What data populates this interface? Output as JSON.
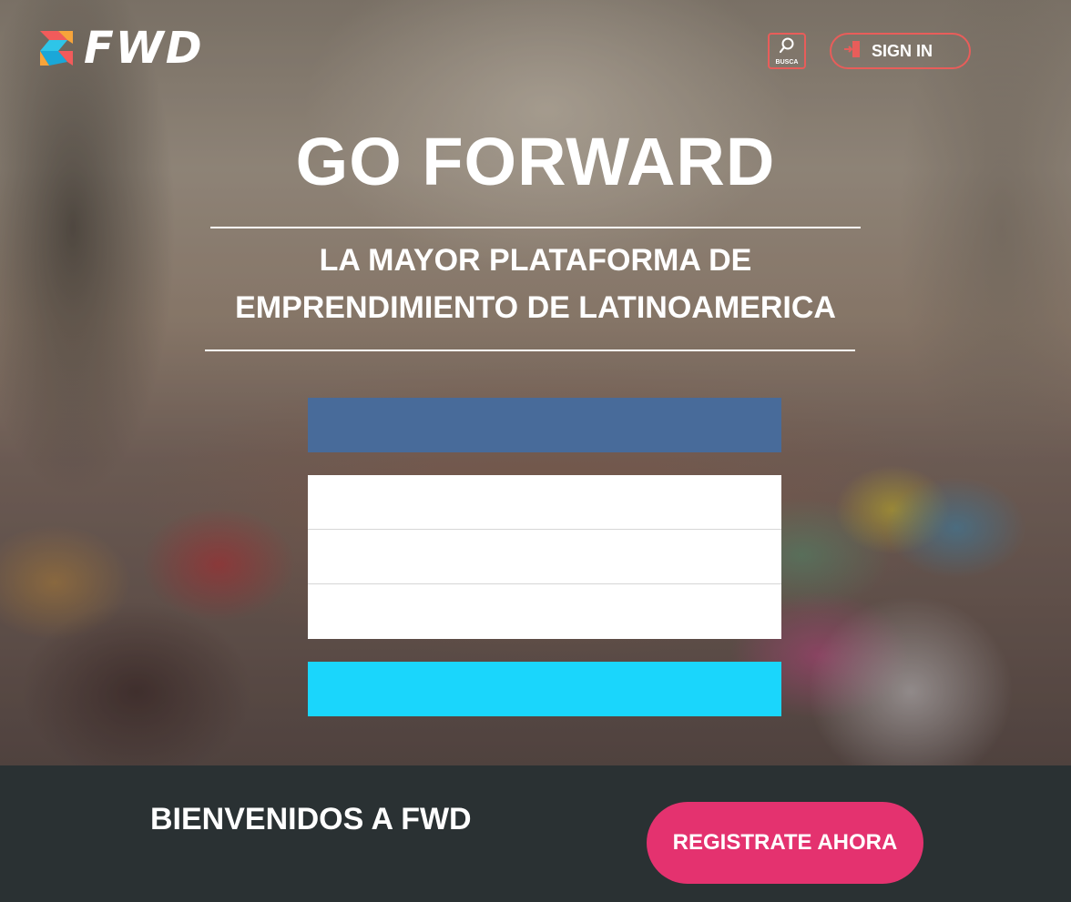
{
  "header": {
    "logo_text": "FWD",
    "search_label": "BUSCA",
    "signin_label": "SIGN IN"
  },
  "hero": {
    "title": "GO FORWARD",
    "subtitle_line1": "LA MAYOR PLATAFORMA DE",
    "subtitle_line2": "EMPRENDIMIENTO DE LATINOAMERICA"
  },
  "form": {
    "facebook_button_label": "",
    "fields": [
      "",
      "",
      ""
    ],
    "submit_label": ""
  },
  "footer": {
    "welcome_text": "BIENVENIDOS A FWD",
    "register_label": "REGISTRATE AHORA"
  },
  "colors": {
    "accent_red": "#e85d5a",
    "facebook_blue": "#486b9a",
    "submit_cyan": "#1ad6fc",
    "register_pink": "#e4326f",
    "footer_bg": "#2a3133"
  }
}
